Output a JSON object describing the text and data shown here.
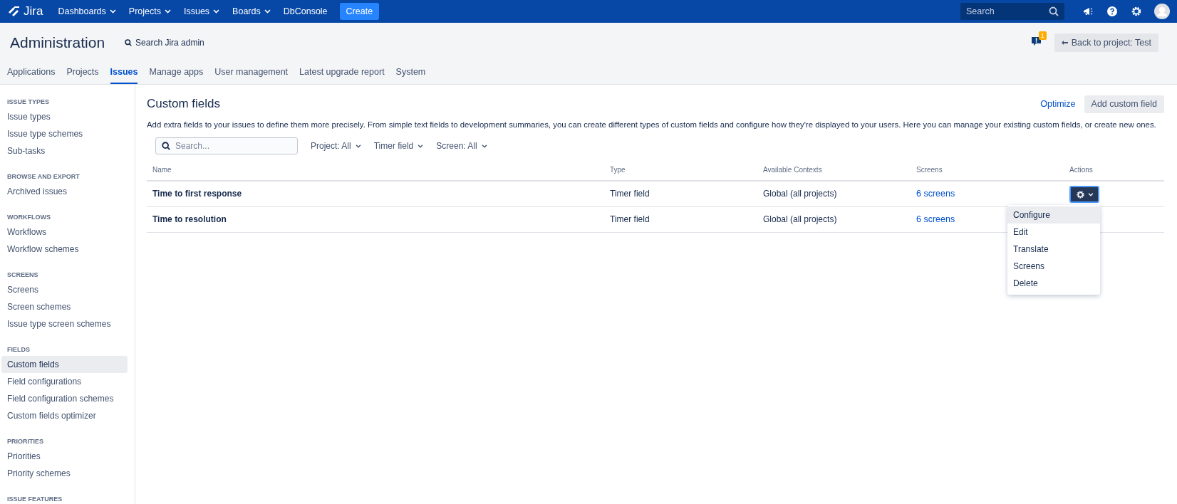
{
  "topbar": {
    "logo": "Jira",
    "menus": [
      {
        "label": "Dashboards",
        "dropdown": true
      },
      {
        "label": "Projects",
        "dropdown": true
      },
      {
        "label": "Issues",
        "dropdown": true
      },
      {
        "label": "Boards",
        "dropdown": true
      },
      {
        "label": "DbConsole",
        "dropdown": false
      }
    ],
    "create": "Create",
    "search": {
      "placeholder": "Search"
    }
  },
  "header": {
    "title": "Administration",
    "search_admin": "Search Jira admin",
    "notification_count": "1",
    "back_button": "Back to project: Test"
  },
  "tabs": [
    {
      "label": "Applications",
      "selected": false
    },
    {
      "label": "Projects",
      "selected": false
    },
    {
      "label": "Issues",
      "selected": true
    },
    {
      "label": "Manage apps",
      "selected": false
    },
    {
      "label": "User management",
      "selected": false
    },
    {
      "label": "Latest upgrade report",
      "selected": false
    },
    {
      "label": "System",
      "selected": false
    }
  ],
  "sidebar": {
    "sections": [
      {
        "title": "ISSUE TYPES",
        "items": [
          {
            "label": "Issue types",
            "selected": false
          },
          {
            "label": "Issue type schemes",
            "selected": false
          },
          {
            "label": "Sub-tasks",
            "selected": false
          }
        ]
      },
      {
        "title": "BROWSE AND EXPORT",
        "items": [
          {
            "label": "Archived issues",
            "selected": false
          }
        ]
      },
      {
        "title": "WORKFLOWS",
        "items": [
          {
            "label": "Workflows",
            "selected": false
          },
          {
            "label": "Workflow schemes",
            "selected": false
          }
        ]
      },
      {
        "title": "SCREENS",
        "items": [
          {
            "label": "Screens",
            "selected": false
          },
          {
            "label": "Screen schemes",
            "selected": false
          },
          {
            "label": "Issue type screen schemes",
            "selected": false
          }
        ]
      },
      {
        "title": "FIELDS",
        "items": [
          {
            "label": "Custom fields",
            "selected": true
          },
          {
            "label": "Field configurations",
            "selected": false
          },
          {
            "label": "Field configuration schemes",
            "selected": false
          },
          {
            "label": "Custom fields optimizer",
            "selected": false
          }
        ]
      },
      {
        "title": "PRIORITIES",
        "items": [
          {
            "label": "Priorities",
            "selected": false
          },
          {
            "label": "Priority schemes",
            "selected": false
          }
        ]
      },
      {
        "title": "ISSUE FEATURES"
      }
    ]
  },
  "main": {
    "title": "Custom fields",
    "optimize": "Optimize",
    "add_button": "Add custom field",
    "description": "Add extra fields to your issues to define them more precisely. From simple text fields to development summaries, you can create different types of custom fields and configure how they're displayed to your users. Here you can manage your existing custom fields, or create new ones.",
    "search": {
      "placeholder": "Search..."
    },
    "filters": [
      "Project: All",
      "Timer field",
      "Screen: All"
    ],
    "table": {
      "columns": [
        "Name",
        "Type",
        "Available Contexts",
        "Screens",
        "Actions"
      ],
      "rows": [
        {
          "name": "Time to first response",
          "type": "Timer field",
          "contexts": "Global (all projects)",
          "screens": "6 screens",
          "menu_open": true
        },
        {
          "name": "Time to resolution",
          "type": "Timer field",
          "contexts": "Global (all projects)",
          "screens": "6 screens",
          "menu_open": false
        }
      ]
    },
    "actions_menu": [
      {
        "label": "Configure",
        "selected": true
      },
      {
        "label": "Edit",
        "selected": false
      },
      {
        "label": "Translate",
        "selected": false
      },
      {
        "label": "Screens",
        "selected": false
      },
      {
        "label": "Delete",
        "selected": false
      }
    ]
  }
}
